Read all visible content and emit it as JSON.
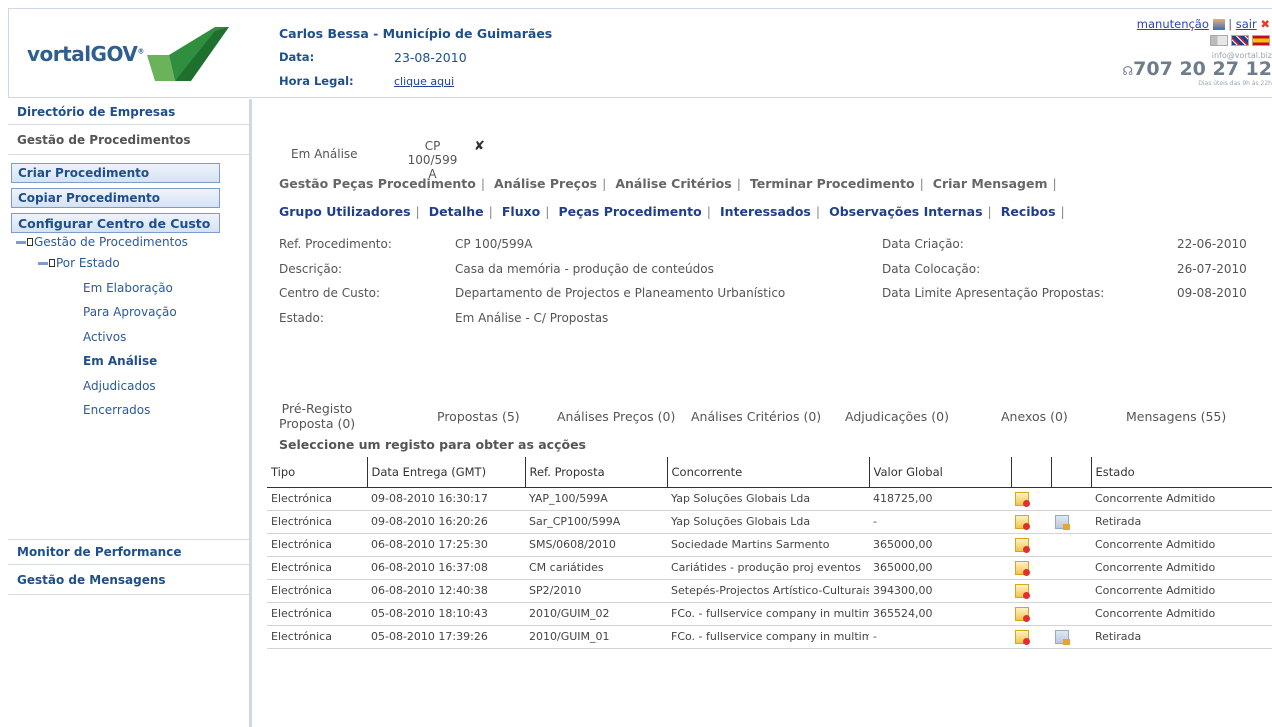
{
  "header": {
    "logo_text": "vortalGOV",
    "organization": "Carlos Bessa - Município de Guimarães",
    "date_label": "Data:",
    "date_value": "23-08-2010",
    "time_label": "Hora Legal:",
    "time_link": "clique aqui",
    "maintenance_link": "manutenção",
    "logout_link": "sair",
    "separator": "|",
    "email": "info@vortal.biz",
    "phone": "707 20 27 12",
    "hours": "Dias úteis das 9h às 22h"
  },
  "sidebar": {
    "directory": "Directório de Empresas",
    "procedures": "Gestão de Procedimentos",
    "buttons": [
      "Criar Procedimento",
      "Copiar Procedimento",
      "Configurar Centro de Custo"
    ],
    "tree_root": "Gestão de Procedimentos",
    "tree_by_state": "Por Estado",
    "states": [
      "Em Elaboração",
      "Para Aprovação",
      "Activos",
      "Em Análise",
      "Adjudicados",
      "Encerrados"
    ],
    "monitor": "Monitor de Performance",
    "messages": "Gestão de Mensagens"
  },
  "main": {
    "subtab_state": "Em Análise",
    "subtab_ref_line1": "CP 100/599",
    "subtab_ref_line2": "A",
    "close_glyph": "✘",
    "menu1": [
      "Gestão Peças Procedimento",
      "Análise Preços",
      "Análise Critérios",
      "Terminar Procedimento",
      "Criar Mensagem"
    ],
    "menu2": [
      "Grupo Utilizadores",
      "Detalhe",
      "Fluxo",
      "Peças Procedimento",
      "Interessados",
      "Observações Internas",
      "Recibos"
    ],
    "details": {
      "ref_label": "Ref. Procedimento:",
      "ref_value": "CP 100/599A",
      "desc_label": "Descrição:",
      "desc_value": "Casa da memória - produção de conteúdos",
      "cost_label": "Centro de Custo:",
      "cost_value": "Departamento de Projectos e Planeamento Urbanístico",
      "state_label": "Estado:",
      "state_value": "Em Análise - C/ Propostas",
      "created_label": "Data Criação:",
      "created_value": "22-06-2010",
      "placed_label": "Data Colocação:",
      "placed_value": "26-07-2010",
      "deadline_label": "Data Limite Apresentação Propostas:",
      "deadline_value": "09-08-2010"
    },
    "tabs": {
      "preregisto_line1": "Pré-Registo",
      "preregisto_line2": "Proposta (0)",
      "propostas": "Propostas (5)",
      "precos": "Análises Preços (0)",
      "criterios": "Análises Critérios (0)",
      "adjudicacoes": "Adjudicações (0)",
      "anexos": "Anexos (0)",
      "mensagens": "Mensagens (55)"
    },
    "hint": "Seleccione um registo para obter as acções",
    "table": {
      "headers": [
        "Tipo",
        "Data Entrega (GMT)",
        "Ref. Proposta",
        "Concorrente",
        "Valor Global",
        "",
        "",
        "Estado"
      ],
      "rows": [
        [
          "Electrónica",
          "09-08-2010 16:30:17",
          "YAP_100/599A",
          "Yap Soluções Globais Lda",
          "418725,00",
          "Concorrente Admitido"
        ],
        [
          "Electrónica",
          "09-08-2010 16:20:26",
          "Sar_CP100/599A",
          "Yap Soluções Globais Lda",
          "-",
          "Retirada"
        ],
        [
          "Electrónica",
          "06-08-2010 17:25:30",
          "SMS/0608/2010",
          "Sociedade Martins Sarmento",
          "365000,00",
          "Concorrente Admitido"
        ],
        [
          "Electrónica",
          "06-08-2010 16:37:08",
          "CM cariátides",
          "Cariátides - produção proj eventos",
          "365000,00",
          "Concorrente Admitido"
        ],
        [
          "Electrónica",
          "06-08-2010 12:40:38",
          "SP2/2010",
          "Setepés-Projectos Artístico-Culturais",
          "394300,00",
          "Concorrente Admitido"
        ],
        [
          "Electrónica",
          "05-08-2010 18:10:43",
          "2010/GUIM_02",
          "FCo. - fullservice company in multimedia",
          "365524,00",
          "Concorrente Admitido"
        ],
        [
          "Electrónica",
          "05-08-2010 17:39:26",
          "2010/GUIM_01",
          "FCo. - fullservice company in multimedia",
          "-",
          "Retirada"
        ]
      ]
    }
  }
}
